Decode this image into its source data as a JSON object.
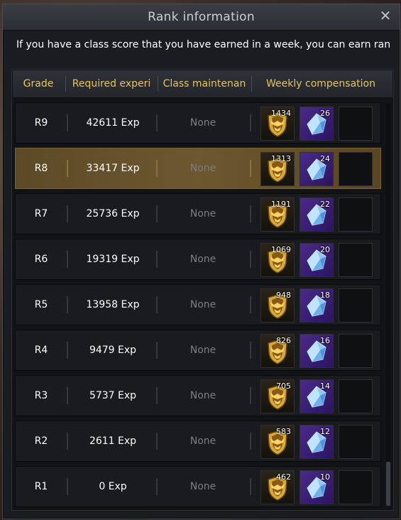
{
  "window": {
    "title": "Rank information",
    "close_symbol": "✕",
    "description": "If you have a class score that you have earned in a week, you can earn ran"
  },
  "table": {
    "headers": {
      "grade": "Grade",
      "required": "Required experi",
      "maintenance": "Class maintenan",
      "compensation": "Weekly compensation"
    },
    "rows": [
      {
        "grade": "R9",
        "exp": "42611 Exp",
        "maint": "None",
        "shield_qty": "1434",
        "gem_qty": "26",
        "active": false
      },
      {
        "grade": "R8",
        "exp": "33417 Exp",
        "maint": "None",
        "shield_qty": "1313",
        "gem_qty": "24",
        "active": true
      },
      {
        "grade": "R7",
        "exp": "25736 Exp",
        "maint": "None",
        "shield_qty": "1191",
        "gem_qty": "22",
        "active": false
      },
      {
        "grade": "R6",
        "exp": "19319 Exp",
        "maint": "None",
        "shield_qty": "1069",
        "gem_qty": "20",
        "active": false
      },
      {
        "grade": "R5",
        "exp": "13958 Exp",
        "maint": "None",
        "shield_qty": "948",
        "gem_qty": "18",
        "active": false
      },
      {
        "grade": "R4",
        "exp": "9479 Exp",
        "maint": "None",
        "shield_qty": "826",
        "gem_qty": "16",
        "active": false
      },
      {
        "grade": "R3",
        "exp": "5737 Exp",
        "maint": "None",
        "shield_qty": "705",
        "gem_qty": "14",
        "active": false
      },
      {
        "grade": "R2",
        "exp": "2611 Exp",
        "maint": "None",
        "shield_qty": "583",
        "gem_qty": "12",
        "active": false
      },
      {
        "grade": "R1",
        "exp": "0 Exp",
        "maint": "None",
        "shield_qty": "462",
        "gem_qty": "10",
        "active": false
      }
    ]
  },
  "icons": {
    "reward_1": "shield-emblem-icon",
    "reward_2": "blue-crystal-icon",
    "reward_3": "empty-slot"
  },
  "colors": {
    "header_text": "#e8c45a",
    "highlight_row": "#6d5730",
    "none_text": "#7a7d83"
  }
}
